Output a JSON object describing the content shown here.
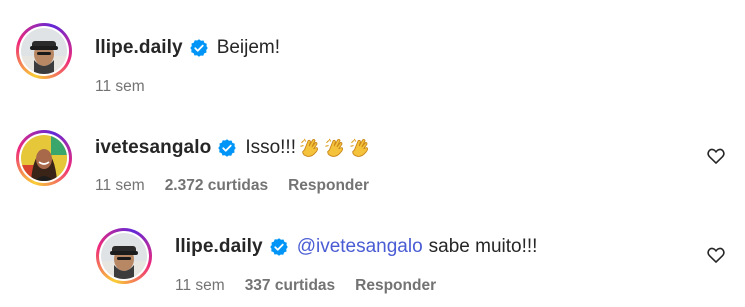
{
  "comments": [
    {
      "username": "llipe.daily",
      "text": "Beijem!",
      "time": "11 sem"
    },
    {
      "username": "ivetesangalo",
      "text": "Isso!!!",
      "emojis": [
        "clapping-hands",
        "clapping-hands",
        "clapping-hands"
      ],
      "time": "11 sem",
      "likes": "2.372 curtidas",
      "reply": "Responder"
    },
    {
      "username": "llipe.daily",
      "mention": "@ivetesangalo",
      "text": "sabe muito!!!",
      "time": "11 sem",
      "likes": "337 curtidas",
      "reply": "Responder"
    }
  ],
  "colors": {
    "verified": "#0095f6",
    "mention": "#4a5cd4",
    "meta": "#737373",
    "text": "#262626"
  }
}
